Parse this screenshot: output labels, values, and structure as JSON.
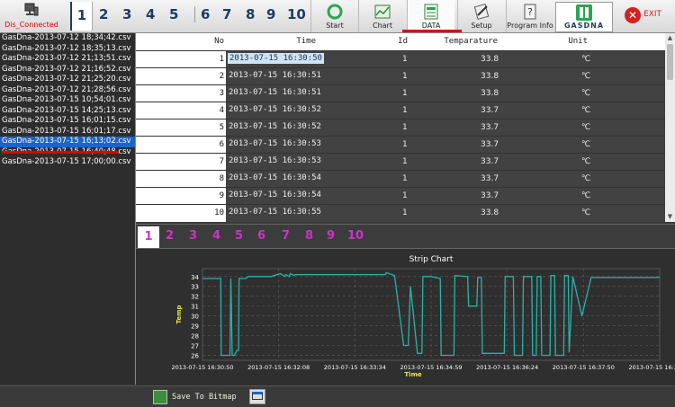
{
  "toolbar": {
    "connection_status": "Dis_Connected",
    "number_tabs": [
      "1",
      "2",
      "3",
      "4",
      "5",
      "6",
      "7",
      "8",
      "9",
      "10"
    ],
    "buttons": {
      "start": "Start",
      "chart": "Chart",
      "data": "DATA",
      "setup": "Setup",
      "program_info": "Program Info"
    },
    "logo_text": "GASDNA",
    "exit_label": "EXIT"
  },
  "files": [
    "GasDna-2013-07-12 18;34;42.csv",
    "GasDna-2013-07-12 18;35;13.csv",
    "GasDna-2013-07-12 21;13;51.csv",
    "GasDna-2013-07-12 21;16;52.csv",
    "GasDna-2013-07-12 21;25;20.csv",
    "GasDna-2013-07-12 21;28;56.csv",
    "GasDna-2013-07-15 10;54;01.csv",
    "GasDna-2013-07-15 14;25;13.csv",
    "GasDna-2013-07-15 16;01;15.csv",
    "GasDna-2013-07-15 16;01;17.csv",
    "GasDna-2013-07-15 16;13;02.csv",
    "GasDna-2013-07-15 16;40;48.csv",
    "GasDna-2013-07-15 17;00;00.csv"
  ],
  "selected_file_index": 10,
  "table": {
    "headers": {
      "no": "No",
      "time": "Time",
      "id": "Id",
      "temperature": "Temparature",
      "unit": "Unit"
    },
    "rows": [
      [
        "1",
        "2013-07-15 16:30:50",
        "1",
        "33.8",
        "℃"
      ],
      [
        "2",
        "2013-07-15 16:30:51",
        "1",
        "33.8",
        "℃"
      ],
      [
        "3",
        "2013-07-15 16:30:51",
        "1",
        "33.8",
        "℃"
      ],
      [
        "4",
        "2013-07-15 16:30:52",
        "1",
        "33.7",
        "℃"
      ],
      [
        "5",
        "2013-07-15 16:30:52",
        "1",
        "33.7",
        "℃"
      ],
      [
        "6",
        "2013-07-15 16:30:53",
        "1",
        "33.7",
        "℃"
      ],
      [
        "7",
        "2013-07-15 16:30:53",
        "1",
        "33.7",
        "℃"
      ],
      [
        "8",
        "2013-07-15 16:30:54",
        "1",
        "33.7",
        "℃"
      ],
      [
        "9",
        "2013-07-15 16:30:54",
        "1",
        "33.7",
        "℃"
      ],
      [
        "10",
        "2013-07-15 16:30:55",
        "1",
        "33.8",
        "℃"
      ]
    ]
  },
  "chart_tabs": [
    "1",
    "2",
    "3",
    "4",
    "5",
    "6",
    "7",
    "8",
    "9",
    "10"
  ],
  "chart_data": {
    "type": "line",
    "title": "Strip Chart",
    "xlabel": "Time",
    "ylabel": "Temp",
    "ylim": [
      25.5,
      34.8
    ],
    "yticks": [
      26,
      27,
      28,
      29,
      30,
      31,
      32,
      33,
      34
    ],
    "xticks": [
      "2013-07-15 16:30:50",
      "2013-07-15 16:32:08",
      "2013-07-15 16:33:34",
      "2013-07-15 16:34:59",
      "2013-07-15 16:36:24",
      "2013-07-15 16:37:50",
      "2013-07-15 16:39:15"
    ],
    "grid": true,
    "series": [
      {
        "color": "#2bb3a8",
        "x": [
          0,
          0.04,
          0.041,
          0.06,
          0.062,
          0.065,
          0.07,
          0.075,
          0.079,
          0.08,
          0.095,
          0.1,
          0.15,
          0.17,
          0.18,
          0.182,
          0.19,
          0.192,
          0.2,
          0.202,
          0.21,
          0.4,
          0.402,
          0.42,
          0.44,
          0.45,
          0.455,
          0.47,
          0.475,
          0.48,
          0.482,
          0.5,
          0.52,
          0.522,
          0.55,
          0.552,
          0.58,
          0.582,
          0.6,
          0.602,
          0.61,
          0.612,
          0.64,
          0.66,
          0.662,
          0.68,
          0.682,
          0.7,
          0.702,
          0.72,
          0.722,
          0.73,
          0.732,
          0.74,
          0.742,
          0.745,
          0.76,
          0.762,
          0.77,
          0.772,
          0.79,
          0.792,
          0.8,
          0.802,
          0.81,
          0.83,
          0.85,
          1.0
        ],
        "values": [
          33.8,
          33.8,
          26.0,
          26.0,
          33.8,
          26.0,
          26.0,
          26.5,
          26.5,
          33.8,
          33.8,
          34.0,
          34.0,
          34.3,
          34.0,
          34.2,
          34.0,
          34.3,
          34.1,
          34.2,
          34.2,
          34.2,
          34.4,
          34.1,
          27.0,
          27.0,
          33.0,
          26.2,
          26.2,
          26.2,
          34.0,
          34.0,
          33.8,
          26.0,
          26.0,
          34.1,
          34.0,
          31.0,
          31.0,
          33.9,
          33.9,
          26.2,
          26.2,
          26.2,
          34.0,
          34.0,
          26.0,
          26.0,
          34.0,
          34.0,
          26.0,
          26.0,
          34.0,
          34.0,
          26.0,
          26.0,
          26.0,
          34.1,
          34.1,
          26.0,
          26.0,
          34.1,
          34.1,
          26.3,
          34.0,
          30.0,
          33.9,
          33.9
        ]
      }
    ]
  },
  "bottom": {
    "save_label": "Save To Bitmap"
  }
}
